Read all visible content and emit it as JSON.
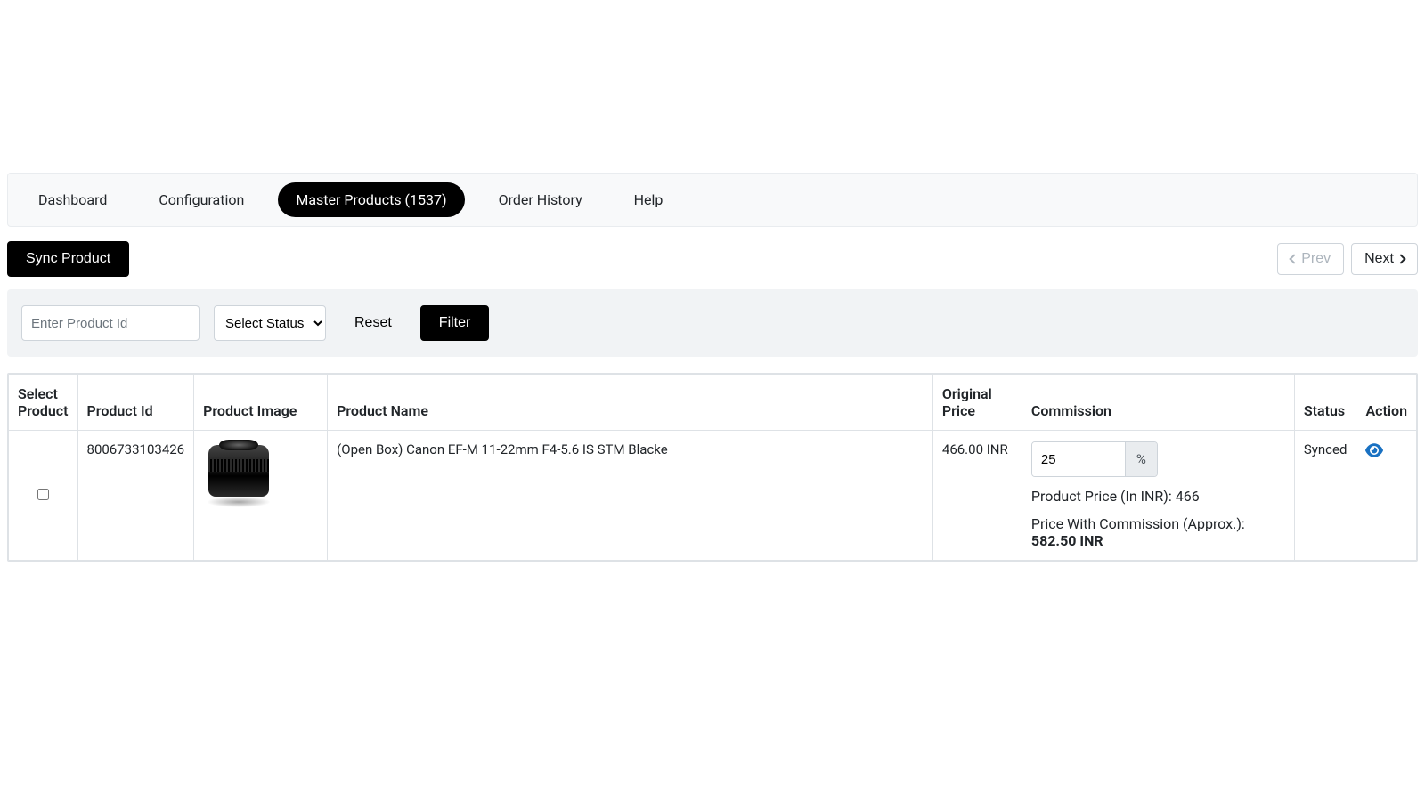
{
  "nav": {
    "items": [
      {
        "label": "Dashboard",
        "active": false
      },
      {
        "label": "Configuration",
        "active": false
      },
      {
        "label": "Master Products (1537)",
        "active": true
      },
      {
        "label": "Order History",
        "active": false
      },
      {
        "label": "Help",
        "active": false
      }
    ]
  },
  "toolbar": {
    "sync_label": "Sync Product",
    "prev_label": "Prev",
    "next_label": "Next"
  },
  "filter": {
    "product_id_placeholder": "Enter Product Id",
    "status_placeholder": "Select Status",
    "reset_label": "Reset",
    "filter_label": "Filter"
  },
  "table": {
    "headers": {
      "select": "Select Product",
      "pid": "Product Id",
      "img": "Product Image",
      "name": "Product Name",
      "oprice": "Original Price",
      "comm": "Commission",
      "status": "Status",
      "action": "Action"
    },
    "rows": [
      {
        "selected": false,
        "product_id": "8006733103426",
        "product_name": "(Open Box) Canon EF-M 11-22mm F4-5.6 IS STM Blacke",
        "original_price": "466.00 INR",
        "commission_percent": "25",
        "percent_symbol": "%",
        "price_line": "Product Price (In INR): 466",
        "price_with_commission_label": "Price With Commission (Approx.):",
        "price_with_commission_value": "582.50 INR",
        "status": "Synced"
      }
    ]
  }
}
